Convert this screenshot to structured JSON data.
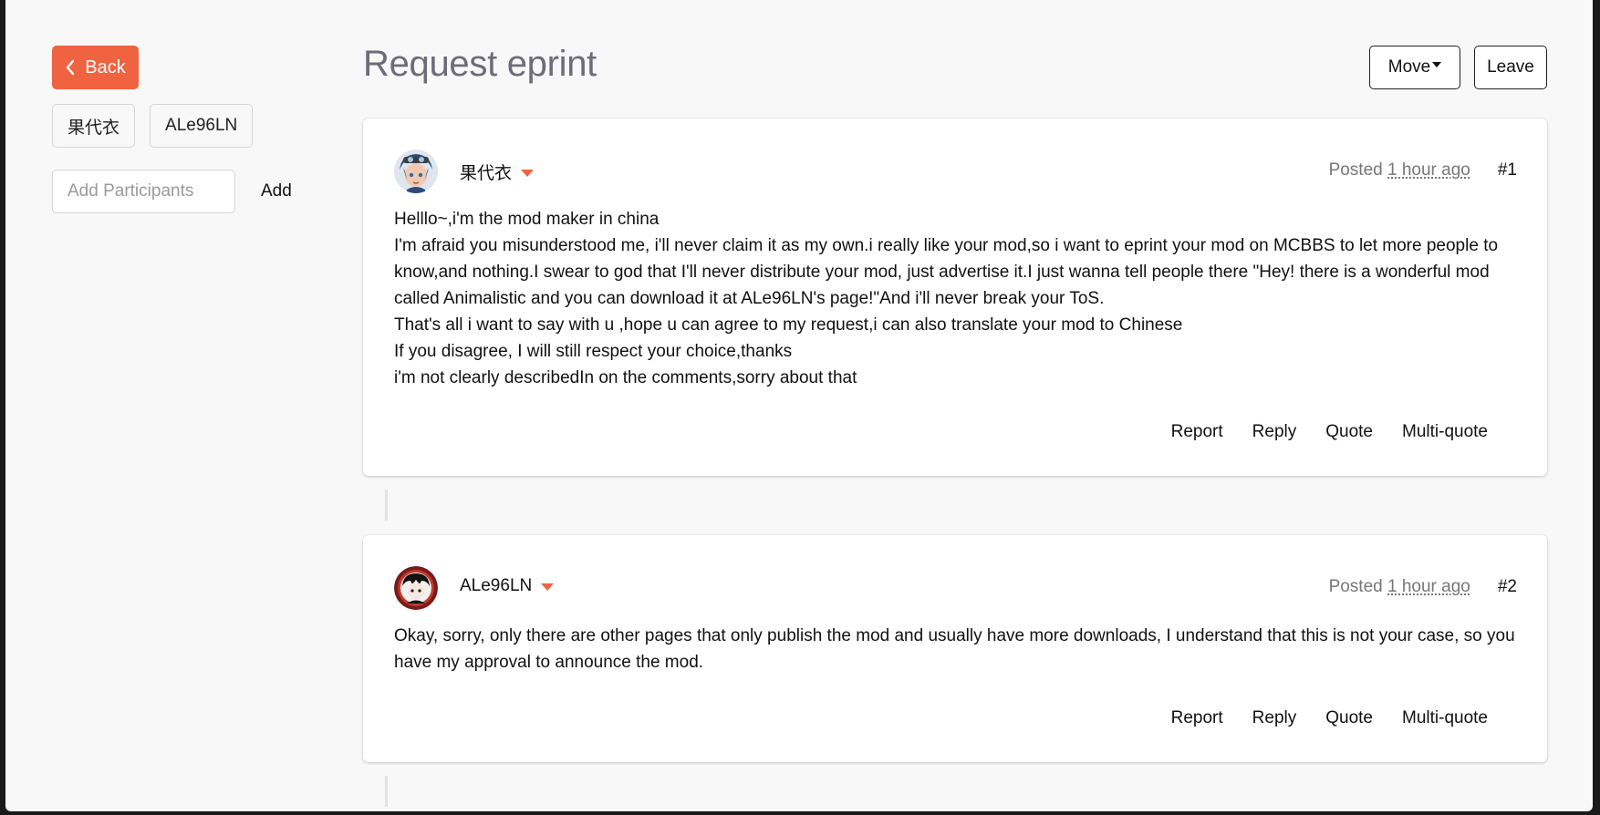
{
  "sidebar": {
    "back_label": "Back",
    "participants": [
      "果代衣",
      "ALe96LN"
    ],
    "add_placeholder": "Add Participants",
    "add_label": "Add"
  },
  "header": {
    "title": "Request eprint",
    "move_label": "Move",
    "leave_label": "Leave"
  },
  "posts": [
    {
      "author": "果代衣",
      "posted_label": "Posted",
      "time": "1 hour ago",
      "number": "#1",
      "lines": [
        "Helllo~,i'm the mod maker in china",
        "I'm afraid you misunderstood me, i'll never claim it as my own.i really like your mod,so i want to eprint your mod on MCBBS to let more people to know,and nothing.I swear to god that I'll never distribute your mod, just advertise it.I just wanna tell people there \"Hey! there is a wonderful mod called Animalistic and you can download it at ALe96LN's page!\"And i'll never break your ToS.",
        "That's all i want to say with u ,hope u can agree to my request,i can also translate your mod to Chinese",
        "If you disagree, I will still respect your choice,thanks",
        "i'm not clearly describedIn on the comments,sorry about that"
      ],
      "actions": [
        "Report",
        "Reply",
        "Quote",
        "Multi-quote"
      ]
    },
    {
      "author": "ALe96LN",
      "posted_label": "Posted",
      "time": "1 hour ago",
      "number": "#2",
      "lines": [
        "Okay, sorry, only there are other pages that only publish the mod and usually have more downloads, I understand that this is not your case, so you have my approval to announce the mod."
      ],
      "actions": [
        "Report",
        "Reply",
        "Quote",
        "Multi-quote"
      ]
    }
  ],
  "colors": {
    "accent": "#ef6340",
    "background": "#f8f8f8",
    "title": "#6d6d7a"
  }
}
